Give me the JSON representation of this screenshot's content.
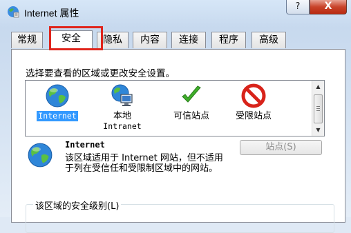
{
  "window": {
    "title": "Internet 属性",
    "help_label": "?",
    "close_label": "X"
  },
  "tabs": [
    {
      "label": "常规",
      "active": false
    },
    {
      "label": "安全",
      "active": true
    },
    {
      "label": "隐私",
      "active": false
    },
    {
      "label": "内容",
      "active": false
    },
    {
      "label": "连接",
      "active": false
    },
    {
      "label": "程序",
      "active": false
    },
    {
      "label": "高级",
      "active": false
    }
  ],
  "security": {
    "prompt": "选择要查看的区域或更改安全设置。",
    "zones": [
      {
        "label": "Internet",
        "sublabel": "",
        "icon": "globe-icon",
        "selected": true
      },
      {
        "label": "本地",
        "sublabel": "Intranet",
        "icon": "local-intranet-icon",
        "selected": false
      },
      {
        "label": "可信站点",
        "sublabel": "",
        "icon": "checkmark-icon",
        "selected": false
      },
      {
        "label": "受限站点",
        "sublabel": "",
        "icon": "no-entry-icon",
        "selected": false
      }
    ],
    "zone_title": "Internet",
    "zone_description": "该区域适用于 Internet 网站，但不适用于列在受信任和受限制区域中的网站。",
    "sites_button": "站点(S)",
    "level_group_label": "该区域的安全级别(L)"
  },
  "colors": {
    "highlight_box": "#e0241b",
    "selection": "#3399ff",
    "close_button": "#c8432a"
  }
}
